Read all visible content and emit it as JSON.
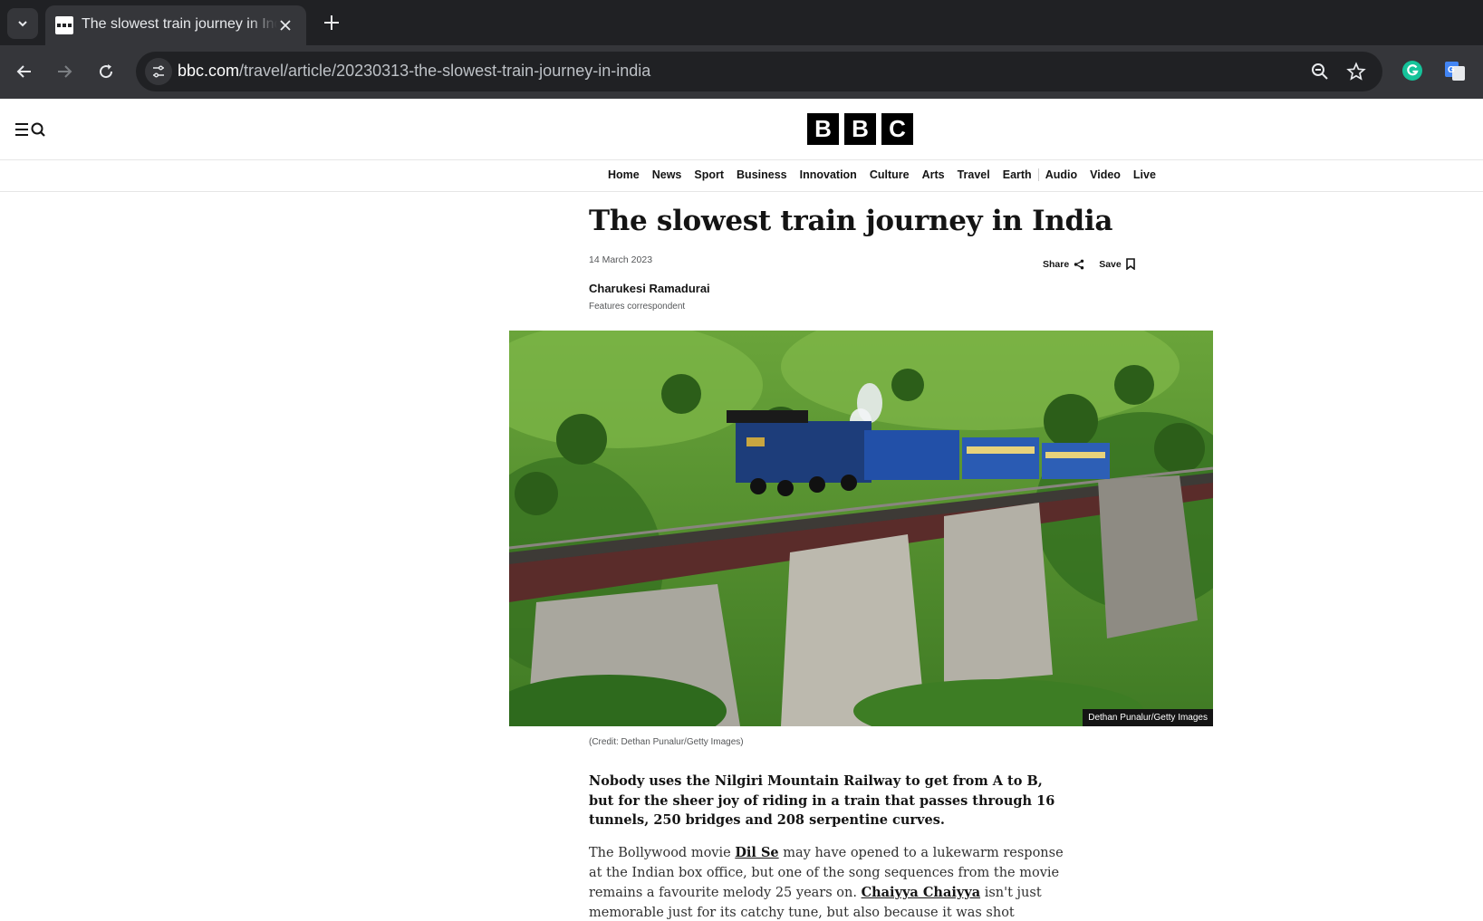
{
  "browser": {
    "tab_title": "The slowest train journey in India",
    "url_domain": "bbc.com",
    "url_path": "/travel/article/20230313-the-slowest-train-journey-in-india"
  },
  "bbc": {
    "logo": [
      "B",
      "B",
      "C"
    ],
    "nav": [
      "Home",
      "News",
      "Sport",
      "Business",
      "Innovation",
      "Culture",
      "Arts",
      "Travel",
      "Earth",
      "Audio",
      "Video",
      "Live"
    ]
  },
  "article": {
    "title": "The slowest train journey in India",
    "date": "14 March 2023",
    "share_label": "Share",
    "save_label": "Save",
    "author": "Charukesi Ramadurai",
    "author_role": "Features correspondent",
    "image_badge": "Dethan Punalur/Getty Images",
    "caption": "(Credit: Dethan Punalur/Getty Images)",
    "lead": "Nobody uses the Nilgiri Mountain Railway to get from A to B, but for the sheer joy of riding in a train that passes through 16 tunnels, 250 bridges and 208 serpentine curves.",
    "body_1": "The Bollywood movie ",
    "link_1": "Dil Se",
    "body_2": " may have opened to a lukewarm response at the Indian box office, but one of the song sequences from the movie remains a favourite melody 25 years on. ",
    "link_2": "Chaiyya Chaiyya",
    "body_3": " isn't just memorable just for its catchy tune, but also because it was shot entirely"
  }
}
